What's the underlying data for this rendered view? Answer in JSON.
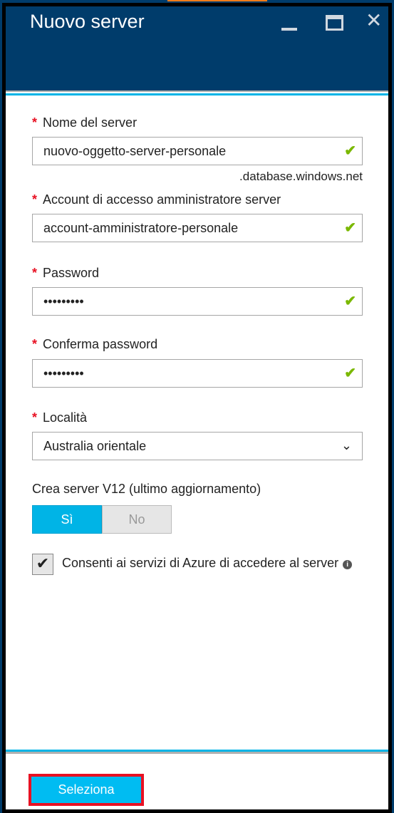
{
  "header": {
    "title": "Nuovo server"
  },
  "fields": [
    {
      "label": "Nome del server",
      "value": "nuovo-oggetto-server-personale",
      "suffix": ".database.windows.net",
      "required": "*"
    },
    {
      "label": "Account di accesso amministratore server",
      "value": "account-amministratore-personale",
      "required": "*"
    },
    {
      "label": "Password",
      "value": "•••••••••",
      "required": "*"
    },
    {
      "label": "Conferma password",
      "value": "•••••••••",
      "required": "*"
    },
    {
      "label": "Località",
      "value": "Australia orientale",
      "required": "*"
    }
  ],
  "v12": {
    "label": "Crea server V12 (ultimo aggiornamento)",
    "yes": "Sì",
    "no": "No",
    "selected": "Sì"
  },
  "azure_access": {
    "label": "Consenti ai servizi di Azure di accedere al server",
    "checked": true
  },
  "footer": {
    "select_label": "Seleziona"
  },
  "colors": {
    "header": "#003c6b",
    "accent": "#00b4e6",
    "valid": "#7ab800",
    "required": "#e81123"
  }
}
